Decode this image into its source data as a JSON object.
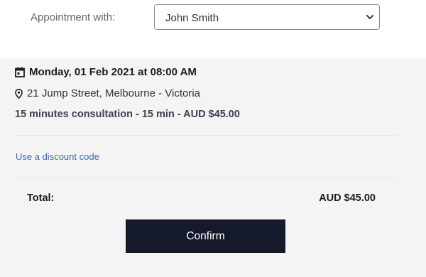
{
  "appointment": {
    "label": "Appointment with:",
    "selected": "John Smith"
  },
  "details": {
    "datetime": "Monday, 01 Feb 2021 at 08:00 AM",
    "address": "21 Jump Street, Melbourne - Victoria",
    "service": "15 minutes consultation - 15 min - AUD $45.00"
  },
  "discount": {
    "link_text": "Use a discount code"
  },
  "total": {
    "label": "Total:",
    "value": "AUD $45.00"
  },
  "actions": {
    "confirm_label": "Confirm"
  },
  "icons": {
    "calendar": "calendar-icon",
    "location": "map-pin-icon",
    "dropdown": "chevron-down-icon"
  },
  "colors": {
    "panel_bg": "#f4f4f4",
    "button_bg": "#141a2a",
    "link": "#3c6aa5"
  }
}
